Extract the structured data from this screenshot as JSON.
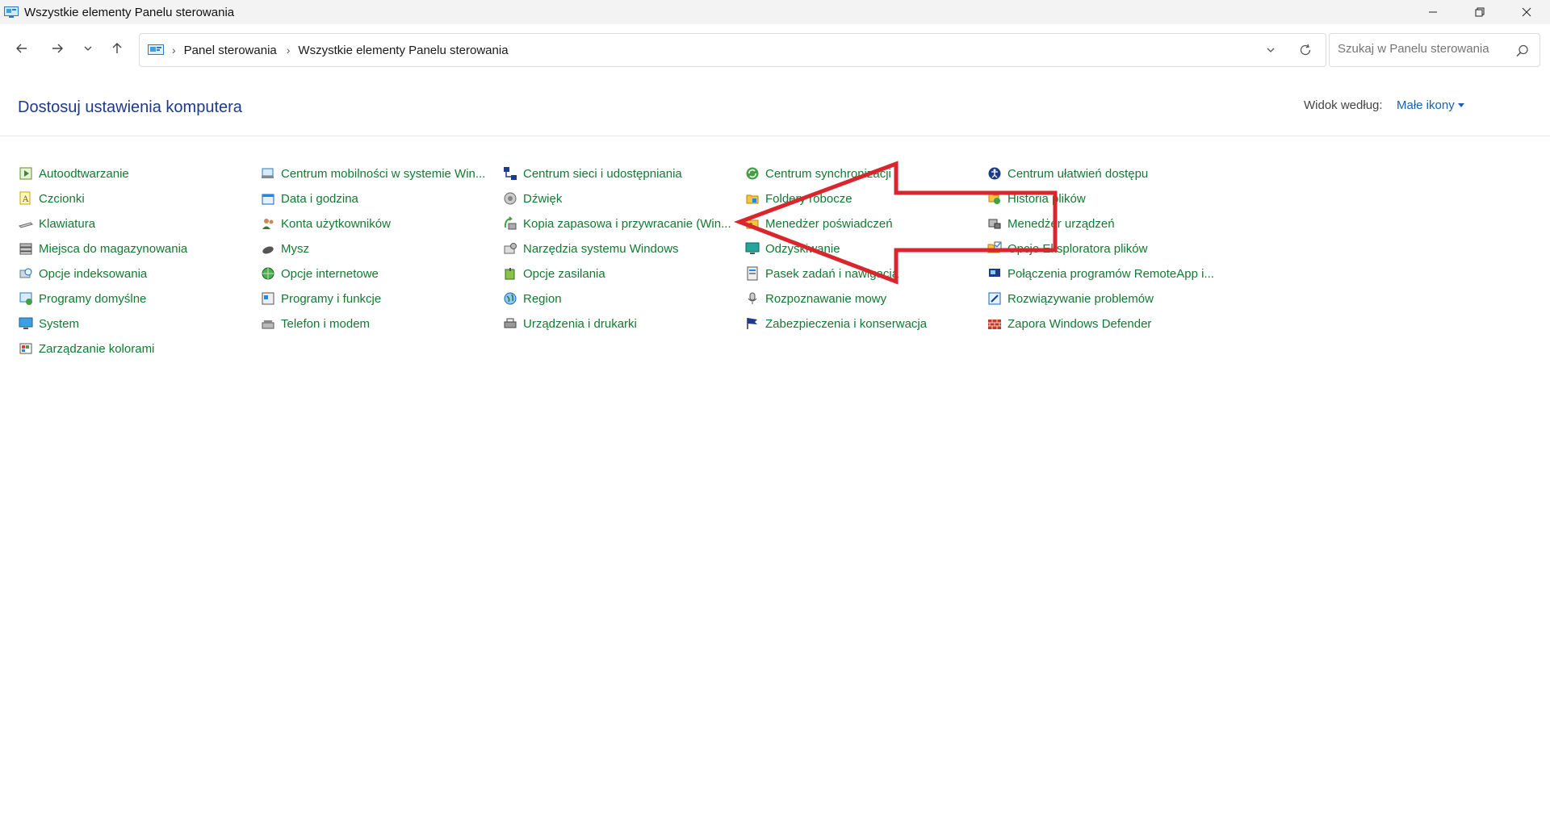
{
  "window": {
    "title": "Wszystkie elementy Panelu sterowania"
  },
  "nav": {
    "breadcrumb": [
      "Panel sterowania",
      "Wszystkie elementy Panelu sterowania"
    ],
    "search_placeholder": "Szukaj w Panelu sterowania"
  },
  "header": {
    "title": "Dostosuj ustawienia komputera",
    "view_by_label": "Widok według:",
    "view_by_value": "Małe ikony"
  },
  "columns": [
    [
      {
        "label": "Autoodtwarzanie",
        "icon": "autoplay-icon"
      },
      {
        "label": "Czcionki",
        "icon": "fonts-icon"
      },
      {
        "label": "Klawiatura",
        "icon": "keyboard-icon"
      },
      {
        "label": "Miejsca do magazynowania",
        "icon": "storage-spaces-icon"
      },
      {
        "label": "Opcje indeksowania",
        "icon": "indexing-icon"
      },
      {
        "label": "Programy domyślne",
        "icon": "default-programs-icon"
      },
      {
        "label": "System",
        "icon": "system-icon"
      },
      {
        "label": "Zarządzanie kolorami",
        "icon": "color-management-icon"
      }
    ],
    [
      {
        "label": "Centrum mobilności w systemie Win...",
        "icon": "mobility-center-icon"
      },
      {
        "label": "Data i godzina",
        "icon": "date-time-icon"
      },
      {
        "label": "Konta użytkowników",
        "icon": "user-accounts-icon"
      },
      {
        "label": "Mysz",
        "icon": "mouse-icon"
      },
      {
        "label": "Opcje internetowe",
        "icon": "internet-options-icon"
      },
      {
        "label": "Programy i funkcje",
        "icon": "programs-features-icon"
      },
      {
        "label": "Telefon i modem",
        "icon": "phone-modem-icon"
      }
    ],
    [
      {
        "label": "Centrum sieci i udostępniania",
        "icon": "network-center-icon"
      },
      {
        "label": "Dźwięk",
        "icon": "sound-icon"
      },
      {
        "label": "Kopia zapasowa i przywracanie (Win...",
        "icon": "backup-restore-icon"
      },
      {
        "label": "Narzędzia systemu Windows",
        "icon": "windows-tools-icon"
      },
      {
        "label": "Opcje zasilania",
        "icon": "power-options-icon"
      },
      {
        "label": "Region",
        "icon": "region-icon"
      },
      {
        "label": "Urządzenia i drukarki",
        "icon": "devices-printers-icon"
      }
    ],
    [
      {
        "label": "Centrum synchronizacji",
        "icon": "sync-center-icon"
      },
      {
        "label": "Foldery robocze",
        "icon": "work-folders-icon"
      },
      {
        "label": "Menedżer poświadczeń",
        "icon": "credential-manager-icon"
      },
      {
        "label": "Odzyskiwanie",
        "icon": "recovery-icon"
      },
      {
        "label": "Pasek zadań i nawigacja",
        "icon": "taskbar-icon"
      },
      {
        "label": "Rozpoznawanie mowy",
        "icon": "speech-recognition-icon"
      },
      {
        "label": "Zabezpieczenia i konserwacja",
        "icon": "security-maintenance-icon"
      }
    ],
    [
      {
        "label": "Centrum ułatwień dostępu",
        "icon": "ease-of-access-icon"
      },
      {
        "label": "Historia plików",
        "icon": "file-history-icon"
      },
      {
        "label": "Menedżer urządzeń",
        "icon": "device-manager-icon"
      },
      {
        "label": "Opcje Eksploratora plików",
        "icon": "explorer-options-icon"
      },
      {
        "label": "Połączenia programów RemoteApp i...",
        "icon": "remoteapp-icon"
      },
      {
        "label": "Rozwiązywanie problemów",
        "icon": "troubleshooting-icon"
      },
      {
        "label": "Zapora Windows Defender",
        "icon": "firewall-icon"
      }
    ]
  ],
  "colors": {
    "item_text": "#137a32",
    "title_text": "#1e3a8a",
    "link_blue": "#1a5fb4",
    "annotation_red": "#d9252e"
  }
}
